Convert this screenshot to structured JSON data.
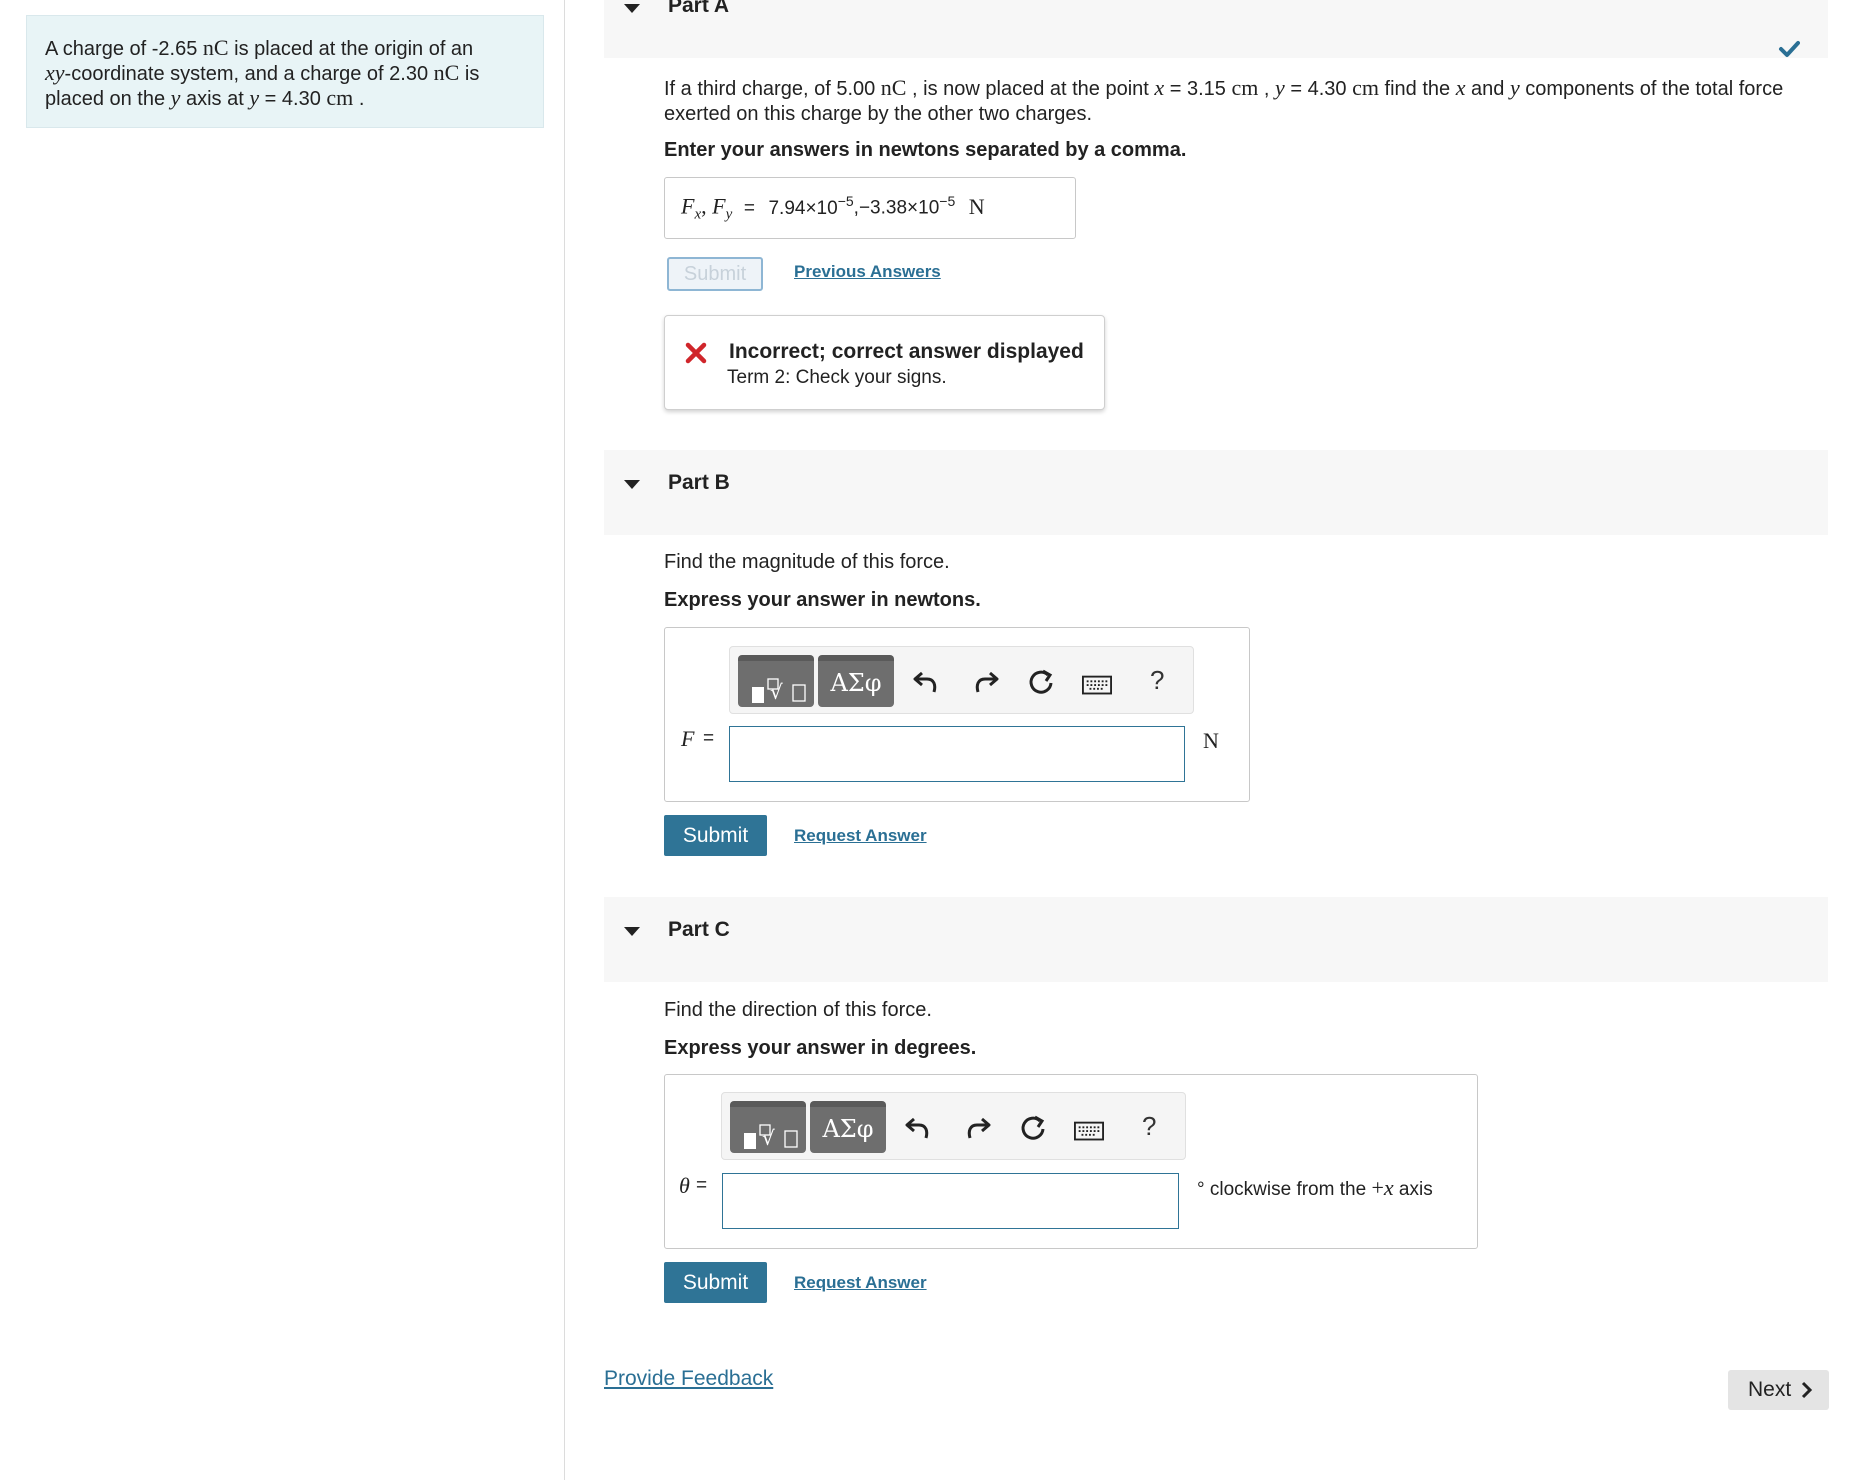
{
  "problem": {
    "line1_a": "A charge of -2.65 ",
    "line1_unit": "nC",
    "line1_b": " is placed at the origin of an",
    "line2_var": "xy",
    "line2_b": "-coordinate system, and a charge of 2.30 ",
    "line2_unit": "nC",
    "line2_c": " is",
    "line3_a": "placed on the ",
    "line3_var": "y",
    "line3_b": " axis at ",
    "line3_var2": "y",
    "line3_c": " = 4.30 ",
    "line3_unit": "cm",
    "line3_d": " ."
  },
  "partA": {
    "title": "Part A",
    "q_a": "If a third charge, of 5.00 ",
    "q_unit1": "nC",
    "q_b": " , is now placed at the point ",
    "q_x": "x",
    "q_c": " = 3.15 ",
    "q_unit2": "cm",
    "q_d": " , ",
    "q_y": "y",
    "q_e": " = 4.30 ",
    "q_unit3": "cm",
    "q_f": " find the ",
    "q_x2": "x",
    "q_g": " and ",
    "q_y2": "y",
    "q_h": " components of the total force",
    "q_line2": "exerted on this charge by the other two charges.",
    "instruction": "Enter your answers in newtons separated by a comma.",
    "answer_label_fx": "F",
    "answer_label_x": "x",
    "answer_label_fy": "F",
    "answer_label_y": "y",
    "answer_eq": "=",
    "answer_value_1": "7.94×10",
    "answer_exp_1": "−5",
    "answer_value_2": ",−3.38×10",
    "answer_exp_2": "−5",
    "answer_unit": "N",
    "submit_label": "Submit",
    "previous_answers": "Previous Answers",
    "feedback_title": "Incorrect; correct answer displayed",
    "feedback_detail": "Term 2: Check your signs."
  },
  "partB": {
    "title": "Part B",
    "question": "Find the magnitude of this force.",
    "instruction": "Express your answer in newtons.",
    "greek_label": "ΑΣφ",
    "help_label": "?",
    "var_label": "F",
    "eq": "=",
    "unit": "N",
    "submit_label": "Submit",
    "request_answer": "Request Answer",
    "input_value": ""
  },
  "partC": {
    "title": "Part C",
    "question": "Find the direction of this force.",
    "instruction": "Express your answer in degrees.",
    "greek_label": "ΑΣφ",
    "help_label": "?",
    "var_label": "θ",
    "eq": "=",
    "unit_prefix": "° clockwise from the ",
    "unit_sign": "+",
    "unit_var": "x",
    "unit_suffix": " axis",
    "submit_label": "Submit",
    "request_answer": "Request Answer",
    "input_value": ""
  },
  "footer": {
    "provide_feedback": "Provide Feedback",
    "next_label": "Next"
  },
  "colors": {
    "accent": "#2f7496",
    "correct_check": "#2a6f94",
    "incorrect_x": "#d0262b",
    "problem_bg": "#e8f4f6"
  },
  "icons": [
    "chevron-down-icon",
    "checkmark-icon",
    "x-mark-icon",
    "templates-icon",
    "undo-icon",
    "redo-icon",
    "reset-icon",
    "keyboard-icon",
    "chevron-right-icon"
  ]
}
